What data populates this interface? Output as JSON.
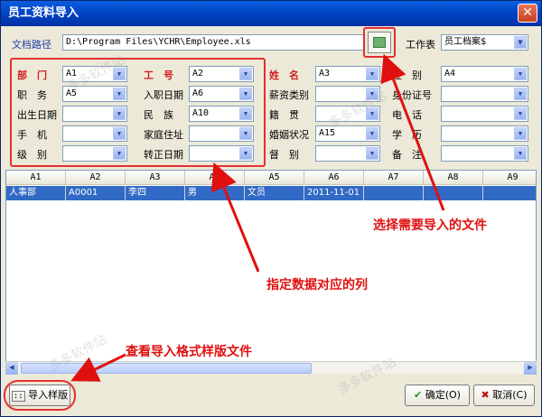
{
  "window": {
    "title": "员工资料导入",
    "close_glyph": "✕"
  },
  "path_label": "文档路径",
  "path_value": "D:\\Program Files\\YCHR\\Employee.xls",
  "sheet_label": "工作表",
  "sheet_value": "员工档案$",
  "fields": [
    {
      "label": "部　门",
      "value": "A1",
      "red": true
    },
    {
      "label": "职　务",
      "value": "A5",
      "red": false
    },
    {
      "label": "出生日期",
      "value": "",
      "red": false
    },
    {
      "label": "手　机",
      "value": "",
      "red": false
    },
    {
      "label": "级　别",
      "value": "",
      "red": false
    },
    {
      "label": "工　号",
      "value": "A2",
      "red": true
    },
    {
      "label": "入职日期",
      "value": "A6",
      "red": false
    },
    {
      "label": "民　族",
      "value": "A10",
      "red": false
    },
    {
      "label": "家庭住址",
      "value": "",
      "red": false
    },
    {
      "label": "转正日期",
      "value": "",
      "red": false
    },
    {
      "label": "姓　名",
      "value": "A3",
      "red": true
    },
    {
      "label": "薪资类别",
      "value": "",
      "red": false
    },
    {
      "label": "籍　贯",
      "value": "",
      "red": false
    },
    {
      "label": "婚姻状况",
      "value": "A15",
      "red": false
    },
    {
      "label": "督　别",
      "value": "",
      "red": false
    },
    {
      "label": "性　别",
      "value": "A4",
      "red": false
    },
    {
      "label": "身份证号",
      "value": "",
      "red": false
    },
    {
      "label": "电　话",
      "value": "",
      "red": false
    },
    {
      "label": "学　历",
      "value": "",
      "red": false
    },
    {
      "label": "备　注",
      "value": "",
      "red": false
    }
  ],
  "grid": {
    "columns": [
      "A1",
      "A2",
      "A3",
      "A4",
      "A5",
      "A6",
      "A7",
      "A8",
      "A9"
    ],
    "rows": [
      [
        "人事部",
        "A0001",
        "李四",
        "男",
        "文员",
        "2011-11-01",
        "",
        "",
        ""
      ]
    ]
  },
  "annotations": {
    "select_file": "选择需要导入的文件",
    "map_columns": "指定数据对应的列",
    "view_template": "查看导入格式样版文件"
  },
  "buttons": {
    "template": "导入样版",
    "ok": "确定(O)",
    "cancel": "取消(C)"
  },
  "watermark": "多多软件站"
}
